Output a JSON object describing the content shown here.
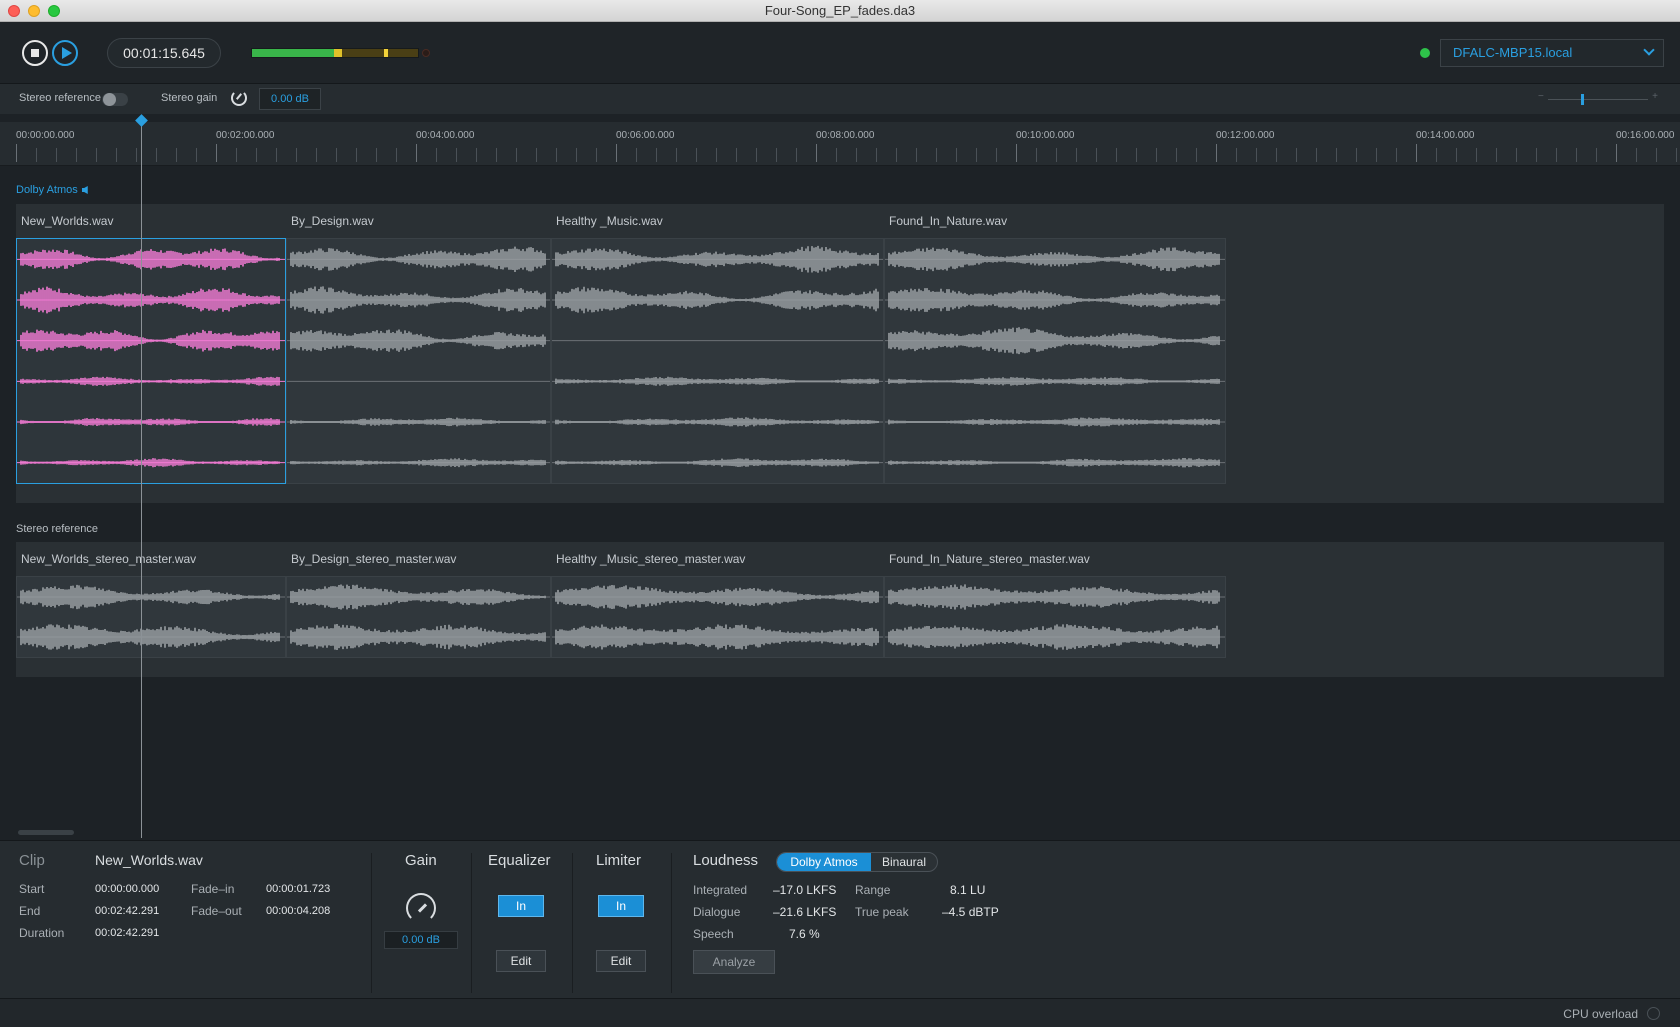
{
  "window": {
    "title": "Four-Song_EP_fades.da3"
  },
  "transport": {
    "timecode": "00:01:15.645",
    "meter_level": 0.49,
    "device": "DFALC-MBP15.local"
  },
  "subbar": {
    "stereo_reference_label": "Stereo reference",
    "stereo_gain_label": "Stereo gain",
    "stereo_gain_value": "0.00 dB",
    "zoom_minus": "−",
    "zoom_plus": "+"
  },
  "ruler": {
    "labels": [
      "00:00:00.000",
      "00:02:00.000",
      "00:04:00.000",
      "00:06:00.000",
      "00:08:00.000",
      "00:10:00.000",
      "00:12:00.000",
      "00:14:00.000",
      "00:16:00.000"
    ]
  },
  "tracks": {
    "atmos_label": "Dolby Atmos",
    "stereo_label": "Stereo reference",
    "atmos_clips": [
      "New_Worlds.wav",
      "By_Design.wav",
      "Healthy _Music.wav",
      "Found_In_Nature.wav"
    ],
    "stereo_clips": [
      "New_Worlds_stereo_master.wav",
      "By_Design_stereo_master.wav",
      "Healthy _Music_stereo_master.wav",
      "Found_In_Nature_stereo_master.wav"
    ]
  },
  "clip_panel": {
    "title": "Clip",
    "name": "New_Worlds.wav",
    "start_label": "Start",
    "start": "00:00:00.000",
    "end_label": "End",
    "end": "00:02:42.291",
    "duration_label": "Duration",
    "duration": "00:02:42.291",
    "fadein_label": "Fade–in",
    "fadein": "00:00:01.723",
    "fadeout_label": "Fade–out",
    "fadeout": "00:00:04.208"
  },
  "gain_panel": {
    "title": "Gain",
    "value": "0.00 dB"
  },
  "eq_panel": {
    "title": "Equalizer",
    "in_label": "In",
    "edit_label": "Edit"
  },
  "limiter_panel": {
    "title": "Limiter",
    "in_label": "In",
    "edit_label": "Edit"
  },
  "loudness_panel": {
    "title": "Loudness",
    "tab_atmos": "Dolby Atmos",
    "tab_binaural": "Binaural",
    "integrated_label": "Integrated",
    "integrated": "–17.0 LKFS",
    "dialogue_label": "Dialogue",
    "dialogue": "–21.6 LKFS",
    "speech_label": "Speech",
    "speech": "7.6 %",
    "range_label": "Range",
    "range": "8.1 LU",
    "truepeak_label": "True peak",
    "truepeak": "–4.5 dBTP",
    "analyze_label": "Analyze"
  },
  "status": {
    "cpu_label": "CPU overload"
  },
  "colors": {
    "accent": "#2a9fe0",
    "selected_wave": "#f07ad2",
    "wave": "#9a9fa3"
  }
}
